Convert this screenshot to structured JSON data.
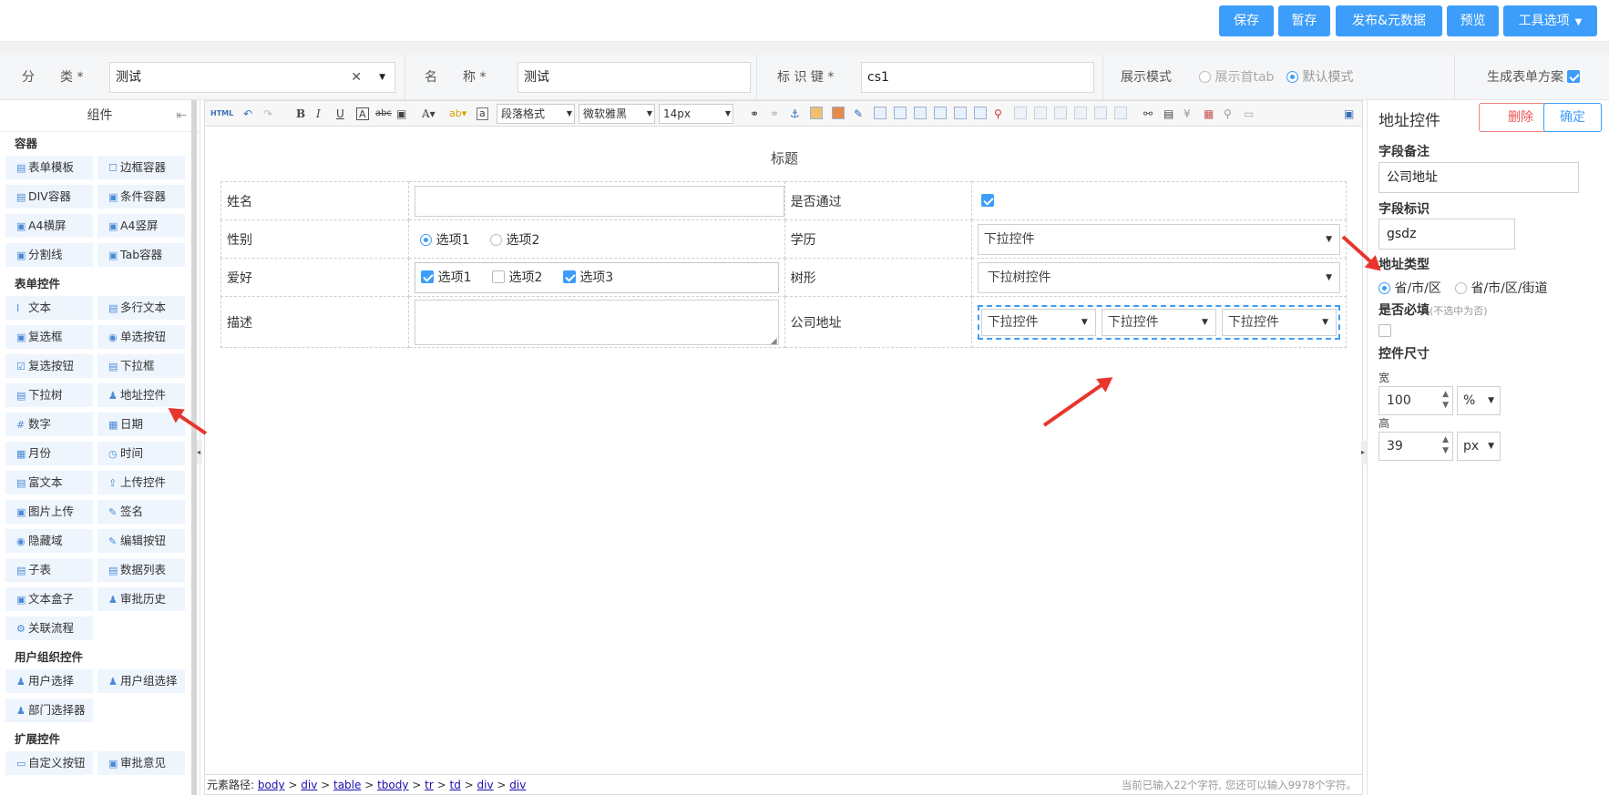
{
  "topbar": {
    "save": "保存",
    "draft": "暂存",
    "publish": "发布&元数据",
    "preview": "预览",
    "tools": "工具选项"
  },
  "fields": {
    "category_label": "分　　类 *",
    "category_value": "测试",
    "name_label": "名　　称 *",
    "name_value": "测试",
    "key_label": "标 识 键 *",
    "key_value": "cs1",
    "display_mode_label": "展示模式",
    "mode_tab": "展示首tab",
    "mode_default": "默认模式",
    "gen_form_label": "生成表单方案"
  },
  "left_panel": {
    "title": "组件",
    "groups": [
      {
        "title": "容器",
        "items": [
          {
            "icon": "▤",
            "label": "表单模板"
          },
          {
            "icon": "☐",
            "label": "边框容器"
          },
          {
            "icon": "▤",
            "label": "DIV容器"
          },
          {
            "icon": "▣",
            "label": "条件容器"
          },
          {
            "icon": "▣",
            "label": "A4横屏"
          },
          {
            "icon": "▣",
            "label": "A4竖屏"
          },
          {
            "icon": "▣",
            "label": "分割线"
          },
          {
            "icon": "▣",
            "label": "Tab容器"
          }
        ]
      },
      {
        "title": "表单控件",
        "items": [
          {
            "icon": "I",
            "label": "文本"
          },
          {
            "icon": "▤",
            "label": "多行文本"
          },
          {
            "icon": "▣",
            "label": "复选框"
          },
          {
            "icon": "◉",
            "label": "单选按钮"
          },
          {
            "icon": "☑",
            "label": "复选按钮"
          },
          {
            "icon": "▤",
            "label": "下拉框"
          },
          {
            "icon": "▤",
            "label": "下拉树"
          },
          {
            "icon": "♟",
            "label": "地址控件"
          },
          {
            "icon": "#",
            "label": "数字"
          },
          {
            "icon": "▦",
            "label": "日期"
          },
          {
            "icon": "▦",
            "label": "月份"
          },
          {
            "icon": "◷",
            "label": "时间"
          },
          {
            "icon": "▤",
            "label": "富文本"
          },
          {
            "icon": "⇪",
            "label": "上传控件"
          },
          {
            "icon": "▣",
            "label": "图片上传"
          },
          {
            "icon": "✎",
            "label": "签名"
          },
          {
            "icon": "◉",
            "label": "隐藏域"
          },
          {
            "icon": "✎",
            "label": "编辑按钮"
          },
          {
            "icon": "▤",
            "label": "子表"
          },
          {
            "icon": "▤",
            "label": "数据列表"
          },
          {
            "icon": "▣",
            "label": "文本盒子"
          },
          {
            "icon": "♟",
            "label": "审批历史"
          },
          {
            "icon": "⚙",
            "label": "关联流程"
          }
        ]
      },
      {
        "title": "用户组织控件",
        "items": [
          {
            "icon": "♟",
            "label": "用户选择"
          },
          {
            "icon": "♟",
            "label": "用户组选择"
          },
          {
            "icon": "♟",
            "label": "部门选择器"
          }
        ]
      },
      {
        "title": "扩展控件",
        "items": [
          {
            "icon": "▭",
            "label": "自定义按钮"
          },
          {
            "icon": "▣",
            "label": "审批意见"
          }
        ]
      }
    ]
  },
  "toolbar": {
    "html": "HTML",
    "para_format": "段落格式",
    "font": "微软雅黑",
    "size": "14px"
  },
  "doc": {
    "title": "标题",
    "rows": [
      {
        "l1": "姓名",
        "l2": "是否通过"
      },
      {
        "l1": "性别",
        "l2": "学历",
        "opt1": "选项1",
        "opt2": "选项2",
        "sel": "下拉控件"
      },
      {
        "l1": "爱好",
        "l2": "树形",
        "c1": "选项1",
        "c2": "选项2",
        "c3": "选项3",
        "tree": "下拉树控件"
      },
      {
        "l1": "描述",
        "l2": "公司地址",
        "a1": "下拉控件",
        "a2": "下拉控件",
        "a3": "下拉控件"
      }
    ]
  },
  "status": {
    "prefix": "元素路径:",
    "path": [
      "body",
      "div",
      "table",
      "tbody",
      "tr",
      "td",
      "div",
      "div"
    ],
    "count": "当前已输入22个字符, 您还可以输入9978个字符。"
  },
  "right_panel": {
    "title": "地址控件",
    "delete": "删除",
    "confirm": "确定",
    "remark_label": "字段备注",
    "remark_value": "公司地址",
    "key_label": "字段标识",
    "key_value": "gsdz",
    "type_label": "地址类型",
    "type_opt1": "省/市/区",
    "type_opt2": "省/市/区/街道",
    "required_label": "是否必填",
    "required_hint": "(不选中为否)",
    "size_label": "控件尺寸",
    "width_label": "宽",
    "width_value": "100",
    "width_unit": "%",
    "height_label": "高",
    "height_value": "39",
    "height_unit": "px"
  }
}
